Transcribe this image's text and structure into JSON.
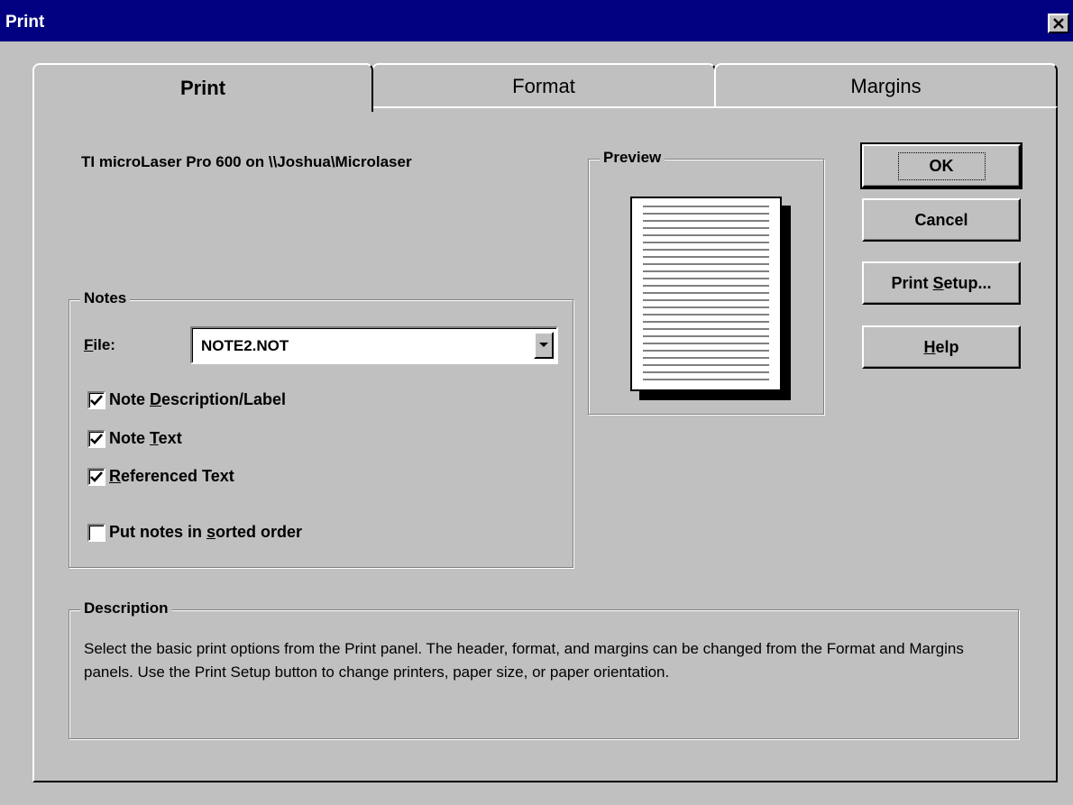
{
  "window": {
    "title": "Print"
  },
  "tabs": [
    {
      "label": "Print",
      "active": true
    },
    {
      "label": "Format",
      "active": false
    },
    {
      "label": "Margins",
      "active": false
    }
  ],
  "printer": {
    "label": "TI microLaser Pro 600 on \\\\Joshua\\Microlaser"
  },
  "notes": {
    "title": "Notes",
    "file_label_prefix": "",
    "file_label_underlined": "F",
    "file_label_rest": "ile:",
    "file_value": "NOTE2.NOT",
    "options": [
      {
        "pre": "Note ",
        "key": "D",
        "post": "escription/Label",
        "checked": true
      },
      {
        "pre": "Note ",
        "key": "T",
        "post": "ext",
        "checked": true
      },
      {
        "pre": "",
        "key": "R",
        "post": "eferenced Text",
        "checked": true
      },
      {
        "pre": "Put notes in ",
        "key": "s",
        "post": "orted order",
        "checked": false
      }
    ]
  },
  "preview": {
    "title": "Preview"
  },
  "buttons": {
    "ok": "OK",
    "cancel": "Cancel",
    "print_setup_pre": "Print ",
    "print_setup_key": "S",
    "print_setup_post": "etup...",
    "help_key": "H",
    "help_post": "elp"
  },
  "description": {
    "title": "Description",
    "text": "Select the basic print options from the Print panel. The header, format, and margins can be changed from the Format and Margins panels. Use the Print Setup button to change printers, paper size, or paper orientation."
  }
}
